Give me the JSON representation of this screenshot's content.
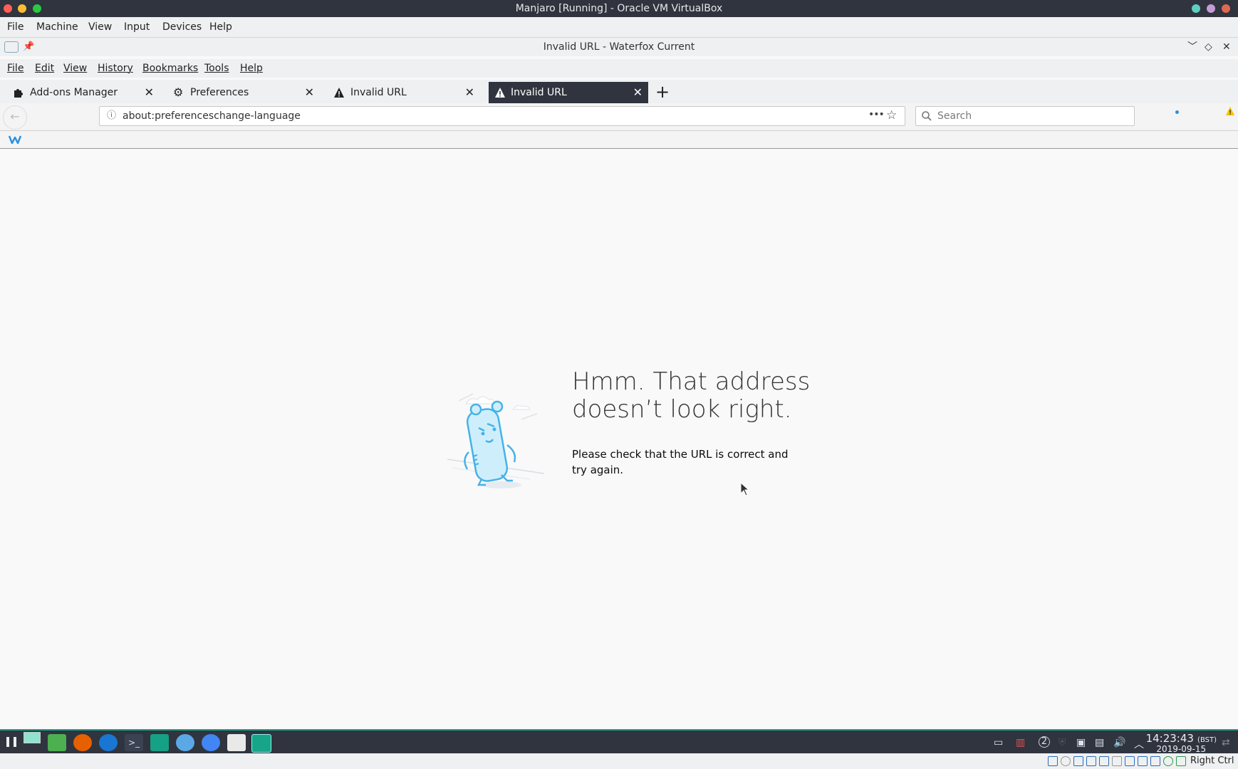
{
  "host_window": {
    "title": "Manjaro [Running] - Oracle VM VirtualBox",
    "menu": [
      "File",
      "Machine",
      "View",
      "Input",
      "Devices",
      "Help"
    ]
  },
  "browser": {
    "window_title": "Invalid URL - Waterfox Current",
    "menu": [
      "File",
      "Edit",
      "View",
      "History",
      "Bookmarks",
      "Tools",
      "Help"
    ],
    "tabs": [
      {
        "label": "Add-ons Manager",
        "icon": "puzzle-icon",
        "active": false
      },
      {
        "label": "Preferences",
        "icon": "gear-icon",
        "active": false
      },
      {
        "label": "Invalid URL",
        "icon": "warning-icon",
        "active": false
      },
      {
        "label": "Invalid URL",
        "icon": "warning-icon",
        "active": true
      }
    ],
    "url": "about:preferenceschange-language",
    "search_placeholder": "Search",
    "page_actions_glyph": "•••"
  },
  "error_page": {
    "title_line1": "Hmm. That address",
    "title_line2": "doesn’t look right.",
    "description": "Please check that the URL is correct and try again."
  },
  "taskbar": {
    "clock_time": "14:23:43",
    "clock_tz": "(BST)",
    "clock_date": "2019-09-15",
    "tray_badge": "2"
  },
  "vbox_status": {
    "host_key": "Right Ctrl"
  },
  "colors": {
    "title_bar": "#2f343f",
    "taskbar_accent": "#16a085",
    "warning": "#f5c400",
    "mascot": "#45b3e7"
  }
}
